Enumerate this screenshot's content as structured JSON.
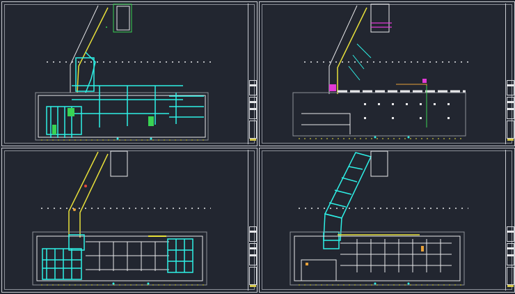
{
  "sheets": [
    {
      "id": "tl",
      "theme": "hvac-duct-plan",
      "accent": "#2ef0e6"
    },
    {
      "id": "tr",
      "theme": "piping-plan",
      "accent": "#e0d63a"
    },
    {
      "id": "bl",
      "theme": "sprinkler-plan",
      "accent": "#2ef0e6"
    },
    {
      "id": "br",
      "theme": "structural-grid-plan",
      "accent": "#2ef0e6"
    }
  ],
  "colors": {
    "background": "#222630",
    "frame": "#c9ccd2",
    "cyan": "#2ef0e6",
    "yellow": "#e8e03a",
    "green": "#39d353",
    "magenta": "#e23ad6",
    "white": "#e8e8ea",
    "red": "#e24a3a",
    "orange": "#e8a23a"
  }
}
